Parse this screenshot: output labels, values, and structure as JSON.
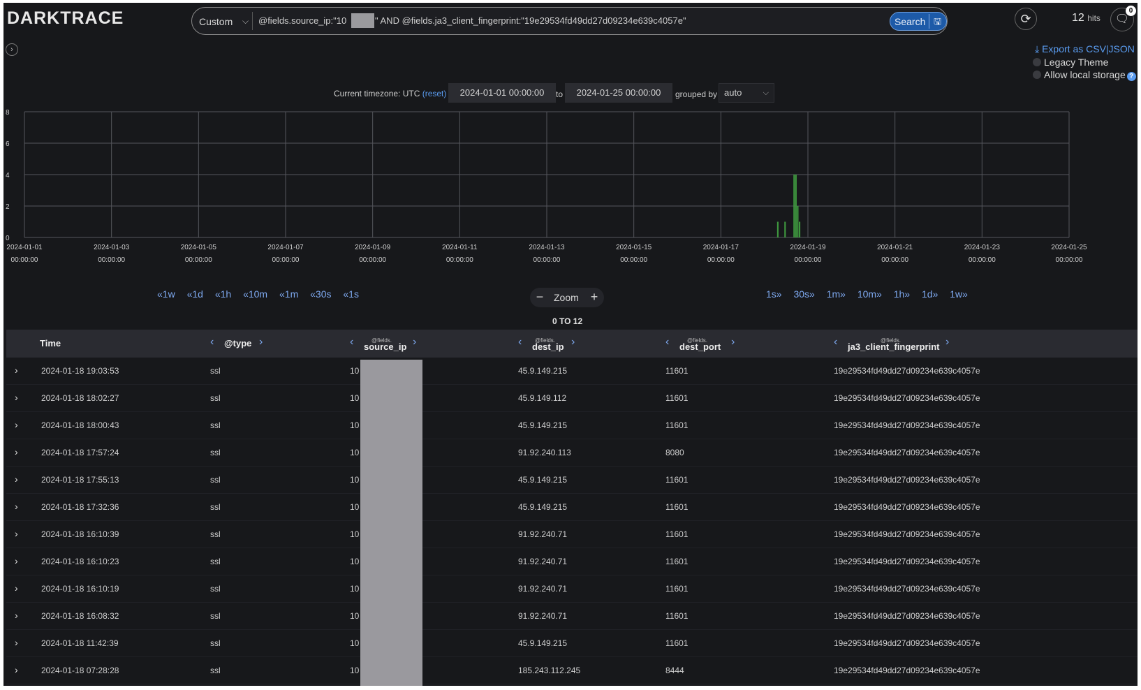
{
  "brand": {
    "logo": "DARKTRACE"
  },
  "search": {
    "mode": "Custom",
    "query_before": "@fields.source_ip:\"10",
    "query_after": "\" AND @fields.ja3_client_fingerprint:\"19e29534fd49dd27d09234e639c4057e\"",
    "button_label": "Search"
  },
  "header": {
    "hits_count": "12",
    "hits_suffix": "hits",
    "notification_count": "0"
  },
  "options": {
    "export_label": "Export as CSV|JSON",
    "legacy_theme_label": "Legacy Theme",
    "local_storage_label": "Allow local storage",
    "help_glyph": "?"
  },
  "timerange": {
    "timezone_prefix": "Current timezone: UTC",
    "reset_label": "(reset)",
    "from": "2024-01-01 00:00:00",
    "to_label": "to",
    "to": "2024-01-25 00:00:00",
    "grouped_by_label": "grouped by",
    "grouped_by_value": "auto"
  },
  "chart_data": {
    "type": "bar",
    "title": "",
    "xlabel": "",
    "ylabel": "",
    "ylim": [
      0,
      8
    ],
    "yticks": [
      "0",
      "2",
      "4",
      "6",
      "8"
    ],
    "xticks": [
      {
        "date": "2024-01-01",
        "time": "00:00:00"
      },
      {
        "date": "2024-01-03",
        "time": "00:00:00"
      },
      {
        "date": "2024-01-05",
        "time": "00:00:00"
      },
      {
        "date": "2024-01-07",
        "time": "00:00:00"
      },
      {
        "date": "2024-01-09",
        "time": "00:00:00"
      },
      {
        "date": "2024-01-11",
        "time": "00:00:00"
      },
      {
        "date": "2024-01-13",
        "time": "00:00:00"
      },
      {
        "date": "2024-01-15",
        "time": "00:00:00"
      },
      {
        "date": "2024-01-17",
        "time": "00:00:00"
      },
      {
        "date": "2024-01-19",
        "time": "00:00:00"
      },
      {
        "date": "2024-01-21",
        "time": "00:00:00"
      },
      {
        "date": "2024-01-23",
        "time": "00:00:00"
      },
      {
        "date": "2024-01-25",
        "time": "00:00:00"
      }
    ],
    "x_start": "2024-01-01 00:00:00",
    "x_end": "2024-01-25 00:00:00",
    "bar_width_hours": 1,
    "bars": [
      {
        "x": "2024-01-18 07:00:00",
        "value": 1
      },
      {
        "x": "2024-01-18 11:00:00",
        "value": 1
      },
      {
        "x": "2024-01-18 16:00:00",
        "value": 4
      },
      {
        "x": "2024-01-18 17:00:00",
        "value": 4
      },
      {
        "x": "2024-01-18 18:00:00",
        "value": 2
      },
      {
        "x": "2024-01-18 19:00:00",
        "value": 1
      }
    ],
    "grid": true,
    "bar_color": "#3f9a3f"
  },
  "nav": {
    "back": [
      "«1w",
      "«1d",
      "«1h",
      "«10m",
      "«1m",
      "«30s",
      "«1s"
    ],
    "forward": [
      "1s»",
      "30s»",
      "1m»",
      "10m»",
      "1h»",
      "1d»",
      "1w»"
    ],
    "zoom_label": "Zoom",
    "zoom_minus": "−",
    "zoom_plus": "+",
    "range_text": "0 TO 12"
  },
  "table": {
    "columns": [
      {
        "prefix": "",
        "name": "Time"
      },
      {
        "prefix": "",
        "name": "@type"
      },
      {
        "prefix": "@fields.",
        "name": "source_ip"
      },
      {
        "prefix": "@fields.",
        "name": "dest_ip"
      },
      {
        "prefix": "@fields.",
        "name": "dest_port"
      },
      {
        "prefix": "@fields.",
        "name": "ja3_client_fingerprint"
      }
    ],
    "rows": [
      {
        "time": "2024-01-18 19:03:53",
        "type": "ssl",
        "source_ip": "10",
        "dest_ip": "45.9.149.215",
        "dest_port": "11601",
        "ja3": "19e29534fd49dd27d09234e639c4057e"
      },
      {
        "time": "2024-01-18 18:02:27",
        "type": "ssl",
        "source_ip": "10",
        "dest_ip": "45.9.149.112",
        "dest_port": "11601",
        "ja3": "19e29534fd49dd27d09234e639c4057e"
      },
      {
        "time": "2024-01-18 18:00:43",
        "type": "ssl",
        "source_ip": "10",
        "dest_ip": "45.9.149.215",
        "dest_port": "11601",
        "ja3": "19e29534fd49dd27d09234e639c4057e"
      },
      {
        "time": "2024-01-18 17:57:24",
        "type": "ssl",
        "source_ip": "10",
        "dest_ip": "91.92.240.113",
        "dest_port": "8080",
        "ja3": "19e29534fd49dd27d09234e639c4057e"
      },
      {
        "time": "2024-01-18 17:55:13",
        "type": "ssl",
        "source_ip": "10",
        "dest_ip": "45.9.149.215",
        "dest_port": "11601",
        "ja3": "19e29534fd49dd27d09234e639c4057e"
      },
      {
        "time": "2024-01-18 17:32:36",
        "type": "ssl",
        "source_ip": "10",
        "dest_ip": "45.9.149.215",
        "dest_port": "11601",
        "ja3": "19e29534fd49dd27d09234e639c4057e"
      },
      {
        "time": "2024-01-18 16:10:39",
        "type": "ssl",
        "source_ip": "10",
        "dest_ip": "91.92.240.71",
        "dest_port": "11601",
        "ja3": "19e29534fd49dd27d09234e639c4057e"
      },
      {
        "time": "2024-01-18 16:10:23",
        "type": "ssl",
        "source_ip": "10",
        "dest_ip": "91.92.240.71",
        "dest_port": "11601",
        "ja3": "19e29534fd49dd27d09234e639c4057e"
      },
      {
        "time": "2024-01-18 16:10:19",
        "type": "ssl",
        "source_ip": "10",
        "dest_ip": "91.92.240.71",
        "dest_port": "11601",
        "ja3": "19e29534fd49dd27d09234e639c4057e"
      },
      {
        "time": "2024-01-18 16:08:32",
        "type": "ssl",
        "source_ip": "10",
        "dest_ip": "91.92.240.71",
        "dest_port": "11601",
        "ja3": "19e29534fd49dd27d09234e639c4057e"
      },
      {
        "time": "2024-01-18 11:42:39",
        "type": "ssl",
        "source_ip": "10",
        "dest_ip": "45.9.149.215",
        "dest_port": "11601",
        "ja3": "19e29534fd49dd27d09234e639c4057e"
      },
      {
        "time": "2024-01-18 07:28:28",
        "type": "ssl",
        "source_ip": "10",
        "dest_ip": "185.243.112.245",
        "dest_port": "8444",
        "ja3": "19e29534fd49dd27d09234e639c4057e"
      }
    ]
  },
  "icons": {
    "expand_row": "chevron-right-icon",
    "refresh": "refresh-icon",
    "chat": "chat-icon",
    "save": "save-icon",
    "download": "download-icon",
    "sidebar_toggle": "chevron-right-icon",
    "col_prev": "chevron-left-icon",
    "col_next": "chevron-right-icon"
  },
  "colors": {
    "background": "#17181b",
    "accent": "#5a9cf0",
    "search_button": "#1d5aa8",
    "bar": "#3f9a3f"
  }
}
